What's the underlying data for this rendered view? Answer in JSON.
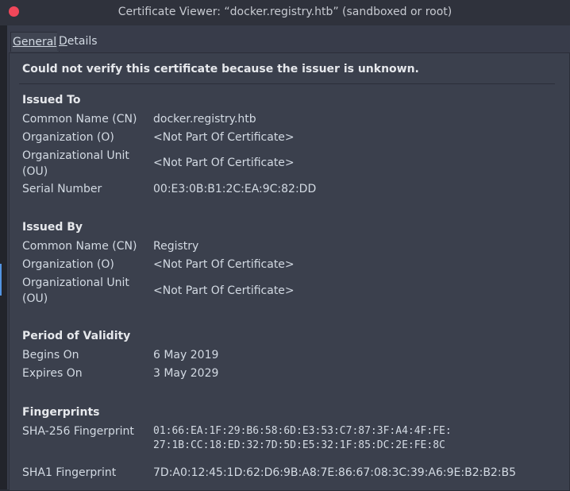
{
  "window": {
    "title": "Certificate Viewer: “docker.registry.htb” (sandboxed or root)"
  },
  "tabs": {
    "general": "General",
    "details_first": "D",
    "details_rest": "etails"
  },
  "warning": "Could not verify this certificate because the issuer is unknown.",
  "issued_to": {
    "title": "Issued To",
    "cn_label": "Common Name (CN)",
    "cn_value": "docker.registry.htb",
    "o_label": "Organization (O)",
    "o_value": "<Not Part Of Certificate>",
    "ou_label_1": "Organizational Unit",
    "ou_label_2": "(OU)",
    "ou_value": "<Not Part Of Certificate>",
    "serial_label": "Serial Number",
    "serial_value": "00:E3:0B:B1:2C:EA:9C:82:DD"
  },
  "issued_by": {
    "title": "Issued By",
    "cn_label": "Common Name (CN)",
    "cn_value": "Registry",
    "o_label": "Organization (O)",
    "o_value": "<Not Part Of Certificate>",
    "ou_label_1": "Organizational Unit",
    "ou_label_2": "(OU)",
    "ou_value": "<Not Part Of Certificate>"
  },
  "validity": {
    "title": "Period of Validity",
    "begins_label": "Begins On",
    "begins_value": "6 May 2019",
    "expires_label": "Expires On",
    "expires_value": "3 May 2029"
  },
  "fingerprints": {
    "title": "Fingerprints",
    "sha256_label": "SHA-256 Fingerprint",
    "sha256_line1": "01:66:EA:1F:29:B6:58:6D:E3:53:C7:87:3F:A4:4F:FE:",
    "sha256_line2": "27:1B:CC:18:ED:32:7D:5D:E5:32:1F:85:DC:2E:FE:8C",
    "sha1_label": "SHA1 Fingerprint",
    "sha1_value": "7D:A0:12:45:1D:62:D6:9B:A8:7E:86:67:08:3C:39:A6:9E:B2:B2:B5"
  },
  "colors": {
    "close_button": "#f0475a",
    "background": "#383c4a",
    "panel": "#3b404d"
  }
}
